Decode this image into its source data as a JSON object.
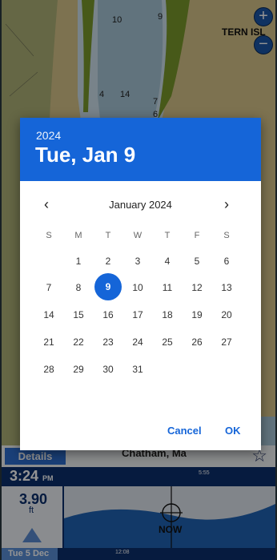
{
  "map": {
    "depths": [
      "10",
      "9",
      "4",
      "14",
      "7",
      "6"
    ],
    "place_label": "TERN ISL",
    "zoom_in": "+",
    "zoom_out": "−",
    "colors": {
      "land": "#d8c58b",
      "grass": "#7a9a2c",
      "shallow": "#a8c6d8",
      "deep": "#cfe2ee"
    }
  },
  "tide_panel": {
    "details_label": "Details",
    "location": "Chatham, Ma",
    "star_icon": "☆",
    "time": "3:24",
    "ampm": "PM",
    "sunset_time": "5:55",
    "height_value": "3.90",
    "height_unit": "ft",
    "now_label": "NOW",
    "date_label": "Tue 5 Dec",
    "bottom_tick": "12:08"
  },
  "date_picker": {
    "year": "2024",
    "selected_date": "Tue, Jan 9",
    "month_label": "January 2024",
    "prev": "‹",
    "next": "›",
    "weekdays": [
      "S",
      "M",
      "T",
      "W",
      "T",
      "F",
      "S"
    ],
    "weeks": [
      [
        "",
        "1",
        "2",
        "3",
        "4",
        "5",
        "6"
      ],
      [
        "7",
        "8",
        "9",
        "10",
        "11",
        "12",
        "13"
      ],
      [
        "14",
        "15",
        "16",
        "17",
        "18",
        "19",
        "20"
      ],
      [
        "21",
        "22",
        "23",
        "24",
        "25",
        "26",
        "27"
      ],
      [
        "28",
        "29",
        "30",
        "31",
        "",
        "",
        ""
      ]
    ],
    "selected_day": "9",
    "cancel_label": "Cancel",
    "ok_label": "OK",
    "accent_color": "#1565d8"
  }
}
